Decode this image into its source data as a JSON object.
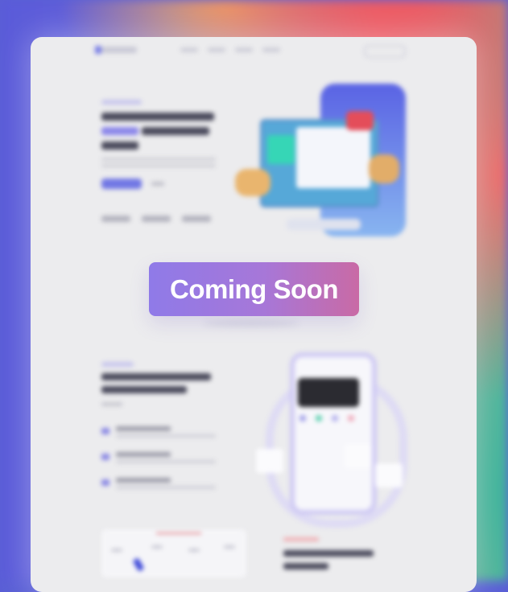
{
  "overlay": {
    "label": "Coming Soon"
  },
  "colors": {
    "badge_gradient_start": "#8f7ae8",
    "badge_gradient_end": "#c96aa5",
    "accent": "#7177e4",
    "page_background": "#ececee"
  },
  "icons": [
    "logo-icon",
    "feature-icon",
    "feature-icon",
    "feature-icon"
  ]
}
